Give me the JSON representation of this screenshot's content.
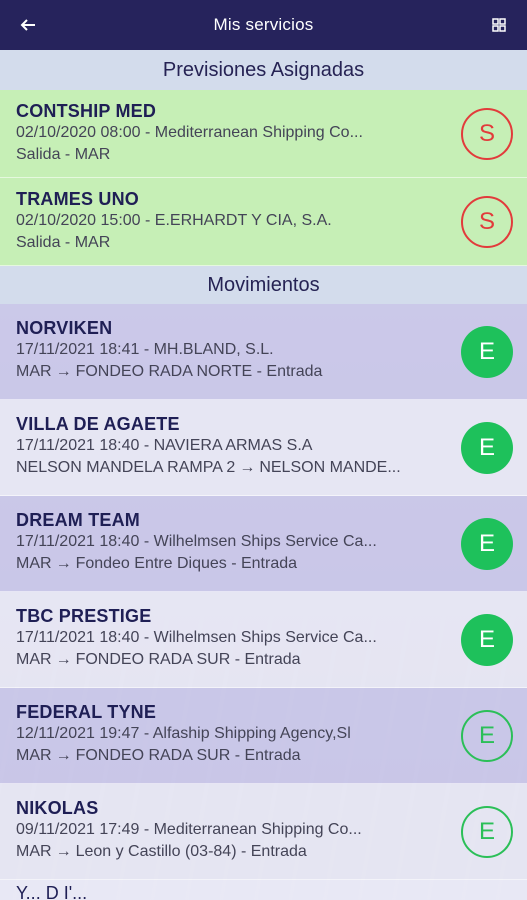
{
  "appbar": {
    "title": "Mis servicios",
    "back_icon": "arrow-left-icon",
    "grid_icon": "grid-icon"
  },
  "previsiones": {
    "header": "Previsiones Asignadas",
    "items": [
      {
        "name": "CONTSHIP MED",
        "line1": "02/10/2020 08:00 - Mediterranean Shipping Co...",
        "line2": "Salida - MAR",
        "badge": "S"
      },
      {
        "name": "TRAMES UNO",
        "line1": "02/10/2020 15:00 - E.ERHARDT Y CIA, S.A.",
        "line2": "Salida - MAR",
        "badge": "S"
      }
    ]
  },
  "movimientos": {
    "header": "Movimientos",
    "items": [
      {
        "name": "NORVIKEN",
        "line1": "17/11/2021 18:41 - MH.BLAND, S.L.",
        "from": "MAR",
        "to": "FONDEO RADA NORTE",
        "suffix": " - Entrada",
        "badge": "E",
        "style": "filled"
      },
      {
        "name": "VILLA DE AGAETE",
        "line1": "17/11/2021 18:40 - NAVIERA ARMAS S.A",
        "from": "NELSON MANDELA RAMPA 2",
        "to": "NELSON MANDE...",
        "suffix": "",
        "badge": "E",
        "style": "filled"
      },
      {
        "name": "DREAM TEAM",
        "line1": "17/11/2021 18:40 - Wilhelmsen Ships Service Ca...",
        "from": "MAR",
        "to": "Fondeo Entre Diques",
        "suffix": " - Entrada",
        "badge": "E",
        "style": "filled"
      },
      {
        "name": "TBC PRESTIGE",
        "line1": "17/11/2021 18:40 - Wilhelmsen Ships Service Ca...",
        "from": "MAR",
        "to": "FONDEO RADA SUR",
        "suffix": " - Entrada",
        "badge": "E",
        "style": "filled"
      },
      {
        "name": "FEDERAL TYNE",
        "line1": "12/11/2021 19:47 - Alfaship Shipping Agency,Sl",
        "from": "MAR",
        "to": "FONDEO RADA SUR",
        "suffix": " - Entrada",
        "badge": "E",
        "style": "outline"
      },
      {
        "name": "NIKOLAS",
        "line1": "09/11/2021 17:49 - Mediterranean Shipping Co...",
        "from": "MAR",
        "to": "Leon y Castillo (03-84)",
        "suffix": " - Entrada",
        "badge": "E",
        "style": "outline"
      }
    ]
  },
  "partial_next": "Y...  D   I'...",
  "colors": {
    "appbar": "#26235c",
    "prevision_bg": "#c6efb6",
    "badge_red": "#e23b3b",
    "badge_green": "#1ec15b"
  }
}
